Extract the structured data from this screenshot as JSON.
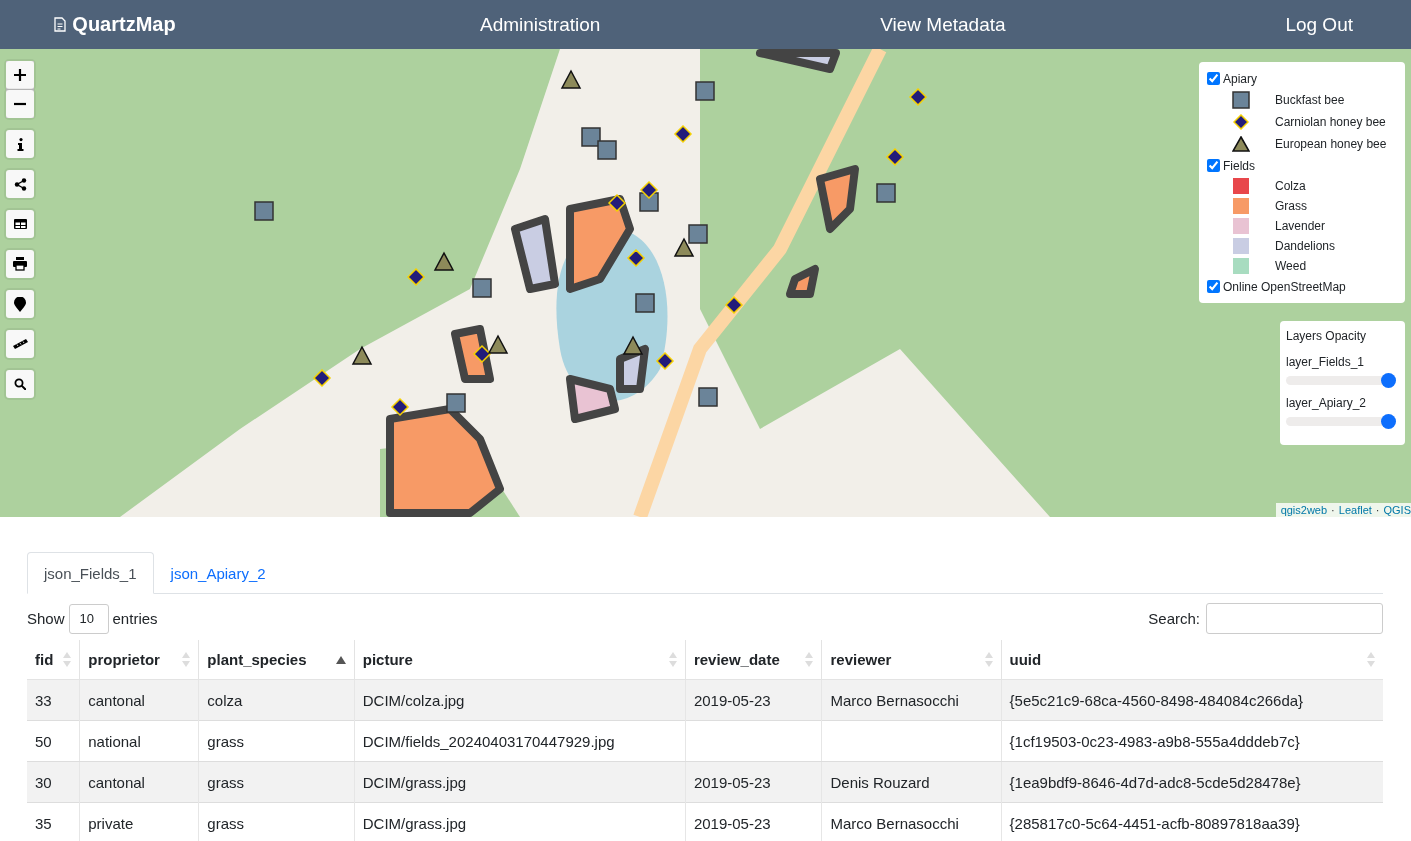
{
  "navbar": {
    "brand": "QuartzMap",
    "links": [
      "Administration",
      "View Metadata",
      "Log Out"
    ]
  },
  "map": {
    "controls": [
      {
        "kind": "zoom-in"
      },
      {
        "kind": "zoom-out"
      },
      {
        "kind": "info"
      },
      {
        "kind": "share"
      },
      {
        "kind": "table"
      },
      {
        "kind": "print"
      },
      {
        "kind": "locate"
      },
      {
        "kind": "measure"
      },
      {
        "kind": "search"
      }
    ],
    "legend": [
      {
        "label": "Apiary",
        "checked": true,
        "items": [
          {
            "label": "Buckfast bee",
            "kind": "square"
          },
          {
            "label": "Carniolan honey bee",
            "kind": "diamond"
          },
          {
            "label": "European honey bee",
            "kind": "triangle"
          }
        ]
      },
      {
        "label": "Fields",
        "checked": true,
        "items": [
          {
            "label": "Colza",
            "kind": "swatch",
            "color": "#e8474b"
          },
          {
            "label": "Grass",
            "kind": "swatch",
            "color": "#f79a66"
          },
          {
            "label": "Lavender",
            "kind": "swatch",
            "color": "#e9c3d3"
          },
          {
            "label": "Dandelions",
            "kind": "swatch",
            "color": "#c9cde3"
          },
          {
            "label": "Weed",
            "kind": "swatch",
            "color": "#a8dcc0"
          }
        ]
      },
      {
        "label": "Online OpenStreetMap",
        "checked": true
      }
    ],
    "opacity": {
      "title": "Layers Opacity",
      "layers": [
        {
          "label": "layer_Fields_1",
          "level": 1
        },
        {
          "label": "layer_Apiary_2",
          "level": 1
        }
      ]
    },
    "attribution": {
      "links": [
        "qgis2web",
        "Leaflet",
        "QGIS"
      ],
      "separator": "·"
    }
  },
  "tabs": [
    {
      "label": "json_Fields_1",
      "selected": true
    },
    {
      "label": "json_Apiary_2",
      "selected": false
    }
  ],
  "table_controls": {
    "show_label": "Show",
    "page_size": "10",
    "entries_label": "entries",
    "search_label": "Search:"
  },
  "table": {
    "columns": [
      {
        "label": "fid",
        "sorted": false
      },
      {
        "label": "proprietor",
        "sorted": false
      },
      {
        "label": "plant_species",
        "sorted": true
      },
      {
        "label": "picture",
        "sorted": false
      },
      {
        "label": "review_date",
        "sorted": false
      },
      {
        "label": "reviewer",
        "sorted": false
      },
      {
        "label": "uuid",
        "sorted": false
      }
    ],
    "rows": [
      [
        "33",
        "cantonal",
        "colza",
        "DCIM/colza.jpg",
        "2019-05-23",
        "Marco Bernasocchi",
        "{5e5c21c9-68ca-4560-8498-484084c266da}"
      ],
      [
        "50",
        "national",
        "grass",
        "DCIM/fields_20240403170447929.jpg",
        "",
        "",
        "{1cf19503-0c23-4983-a9b8-555a4dddeb7c}"
      ],
      [
        "30",
        "cantonal",
        "grass",
        "DCIM/grass.jpg",
        "2019-05-23",
        "Denis Rouzard",
        "{1ea9bdf9-8646-4d7d-adc8-5cde5d28478e}"
      ],
      [
        "35",
        "private",
        "grass",
        "DCIM/grass.jpg",
        "2019-05-23",
        "Marco Bernasocchi",
        "{285817c0-5c64-4451-acfb-80897818aa39}"
      ]
    ]
  }
}
